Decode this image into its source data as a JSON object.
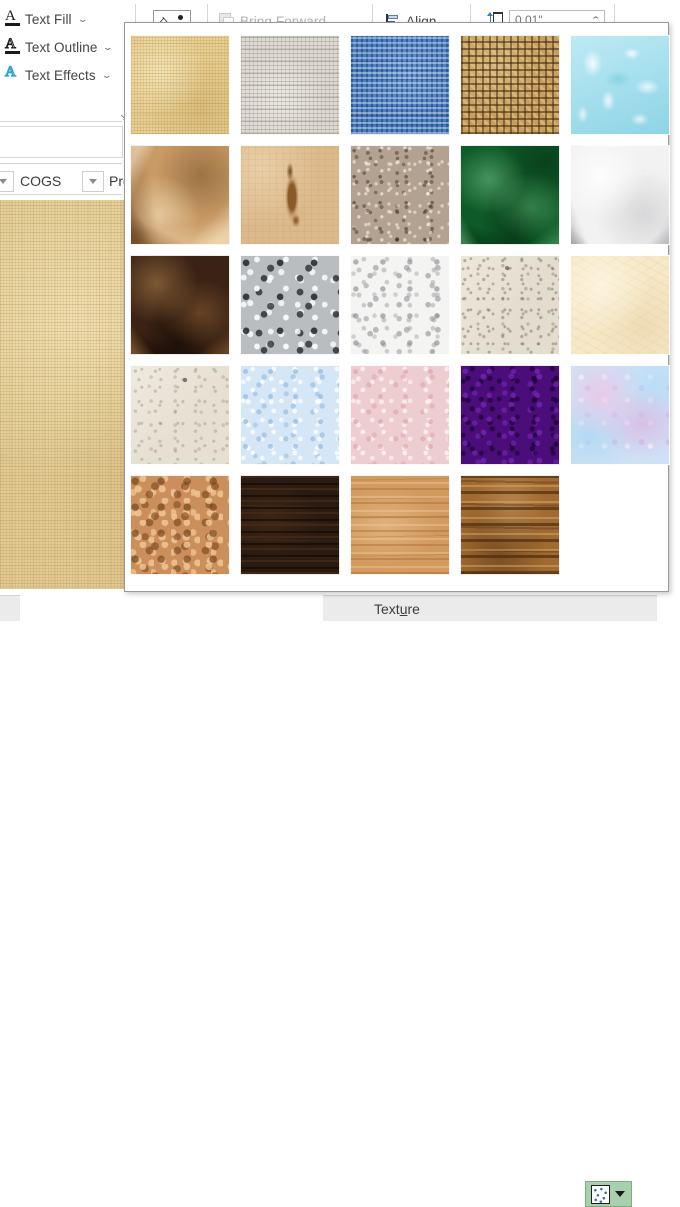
{
  "app": {
    "title": "Texture gallery dropdown"
  },
  "ribbon": {
    "wordart_group": {
      "text_fill": {
        "label": "Text Fill",
        "icon": "letter-a-solid-icon",
        "chevron": "⌄"
      },
      "text_outline": {
        "label": "Text Outline",
        "icon": "letter-a-outline-icon",
        "chevron": "⌄"
      },
      "text_effects": {
        "label": "Text Effects",
        "icon": "letter-a-glow-icon",
        "chevron": "⌄"
      },
      "launcher": "↘"
    },
    "picture_styles_group": {
      "picture_icon": "picture-placeholder-icon",
      "chevron": "⌄"
    },
    "arrange_group": {
      "bring_forward": {
        "label": "Bring Forward",
        "enabled": false,
        "icon": "bring-forward-icon",
        "chevron": "⌄"
      },
      "align": {
        "label": "Align",
        "icon": "align-objects-icon",
        "chevron": "⌄"
      }
    },
    "size_group": {
      "height_icon": "shape-height-icon",
      "height_value": "0.01\"",
      "spin_chevron": "⌃"
    }
  },
  "worksheet": {
    "name_box_chevron": "▼",
    "cell_label_1": "COGS",
    "filter_chevron": "▼",
    "cell_label_2": "Pro"
  },
  "texture_gallery": {
    "name": "Texture gallery",
    "columns": 5,
    "rows": 5,
    "swatches": [
      {
        "name": "Papyrus",
        "class": "tx-papyrus",
        "color": "#e9cf92"
      },
      {
        "name": "Canvas",
        "class": "tx-canvas",
        "color": "#dedad2"
      },
      {
        "name": "Denim",
        "class": "tx-denim",
        "color": "#4a7ec2"
      },
      {
        "name": "Woven mat",
        "class": "tx-wovenmat",
        "color": "#c79e5d"
      },
      {
        "name": "Water droplets",
        "class": "tx-waterdroplets",
        "color": "#a8e2ef"
      },
      {
        "name": "Paper bag",
        "class": "tx-paperbag",
        "color": "#c89a64"
      },
      {
        "name": "Fish fossil",
        "class": "tx-fishfossil",
        "color": "#dcb98b"
      },
      {
        "name": "Sand",
        "class": "tx-sand",
        "color": "#b3a292"
      },
      {
        "name": "Green marble",
        "class": "tx-greenmarble",
        "color": "#0e5a28"
      },
      {
        "name": "White marble",
        "class": "tx-whitemarble",
        "color": "#f2f2f2"
      },
      {
        "name": "Brown marble",
        "class": "tx-brownmarble",
        "color": "#3a2214"
      },
      {
        "name": "Granite",
        "class": "tx-granite",
        "color": "#b9bdc0"
      },
      {
        "name": "Newsprint",
        "class": "tx-newsprint",
        "color": "#f4f4f3"
      },
      {
        "name": "Recycled paper",
        "class": "tx-recycledpaper",
        "color": "#e2ddcf"
      },
      {
        "name": "Parchment",
        "class": "tx-parchment",
        "color": "#f7e8c8"
      },
      {
        "name": "Stationery",
        "class": "tx-stationery",
        "color": "#e6e0d2"
      },
      {
        "name": "Blue tissue paper",
        "class": "tx-bluetissue",
        "color": "#d5e7f7"
      },
      {
        "name": "Pink tissue paper",
        "class": "tx-pinktissue",
        "color": "#eecdd0"
      },
      {
        "name": "Purple mesh",
        "class": "tx-purplemesh",
        "color": "#4a0d7a"
      },
      {
        "name": "Bouquet",
        "class": "tx-bouquet",
        "color": "#cfe2f5"
      },
      {
        "name": "Cork",
        "class": "tx-cork",
        "color": "#cb8f5b"
      },
      {
        "name": "Walnut",
        "class": "tx-walnut",
        "color": "#2a1a10"
      },
      {
        "name": "Oak",
        "class": "tx-oak",
        "color": "#d29a5f"
      },
      {
        "name": "Medium wood",
        "class": "tx-mediumwood",
        "color": "#a06a30"
      }
    ]
  },
  "bottom_bar": {
    "texture_label_prefix": "Text",
    "texture_label_accel": "u",
    "texture_label_suffix": "re",
    "texture_label_full": "Texture",
    "texture_button_icon": "texture-swatch-icon",
    "texture_button_chevron": "▼",
    "texture_button_highlight": "#a9d0ad"
  },
  "canvas": {
    "shape_fill": "Papyrus",
    "shape_color": "#e3cc93"
  }
}
